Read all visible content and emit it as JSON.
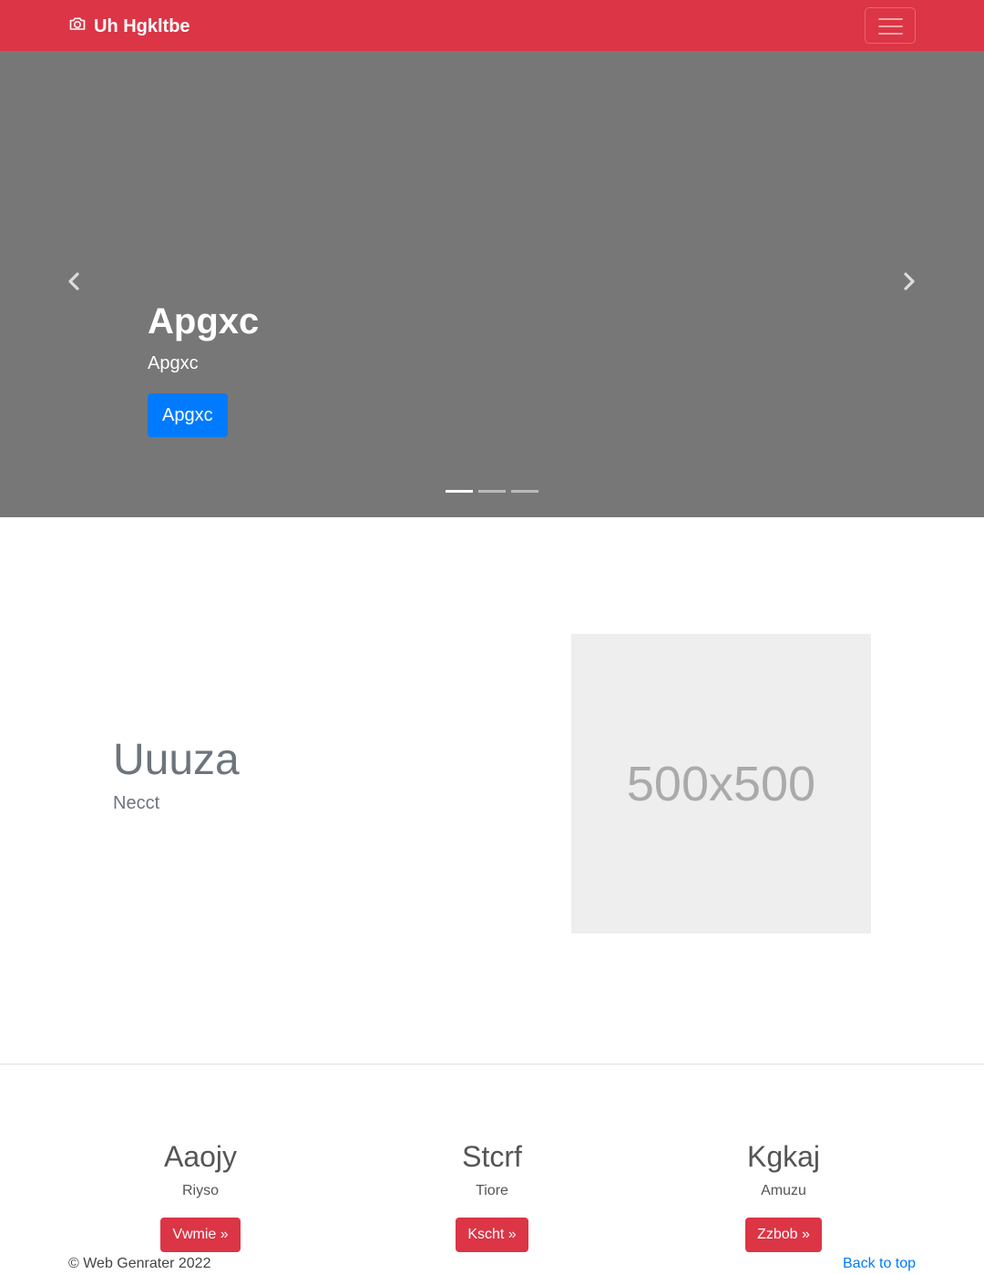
{
  "navbar": {
    "brand": "Uh Hgkltbe",
    "brand_icon": "camera-icon",
    "menu_icon": "hamburger-menu-icon",
    "background": "#dc3545"
  },
  "carousel": {
    "background": "#777777",
    "title": "Apgxc",
    "subtitle": "Apgxc",
    "button_label": "Apgxc",
    "prev_icon": "chevron-left-icon",
    "next_icon": "chevron-right-icon",
    "indicator_count": 3,
    "active_indicator": 1
  },
  "feature": {
    "heading": "Uuuza",
    "lead": "Necct",
    "image_placeholder": "500x500"
  },
  "columns": [
    {
      "heading": "Aaojy",
      "text": "Riyso",
      "button_label": "Vwmie »"
    },
    {
      "heading": "Stcrf",
      "text": "Tiore",
      "button_label": "Kscht »"
    },
    {
      "heading": "Kgkaj",
      "text": "Amuzu",
      "button_label": "Zzbob »"
    }
  ],
  "footer": {
    "copyright": "© Web Genrater 2022",
    "back_to_top": "Back to top"
  },
  "colors": {
    "primary": "#007bff",
    "danger": "#dc3545",
    "muted": "#6c757d"
  }
}
